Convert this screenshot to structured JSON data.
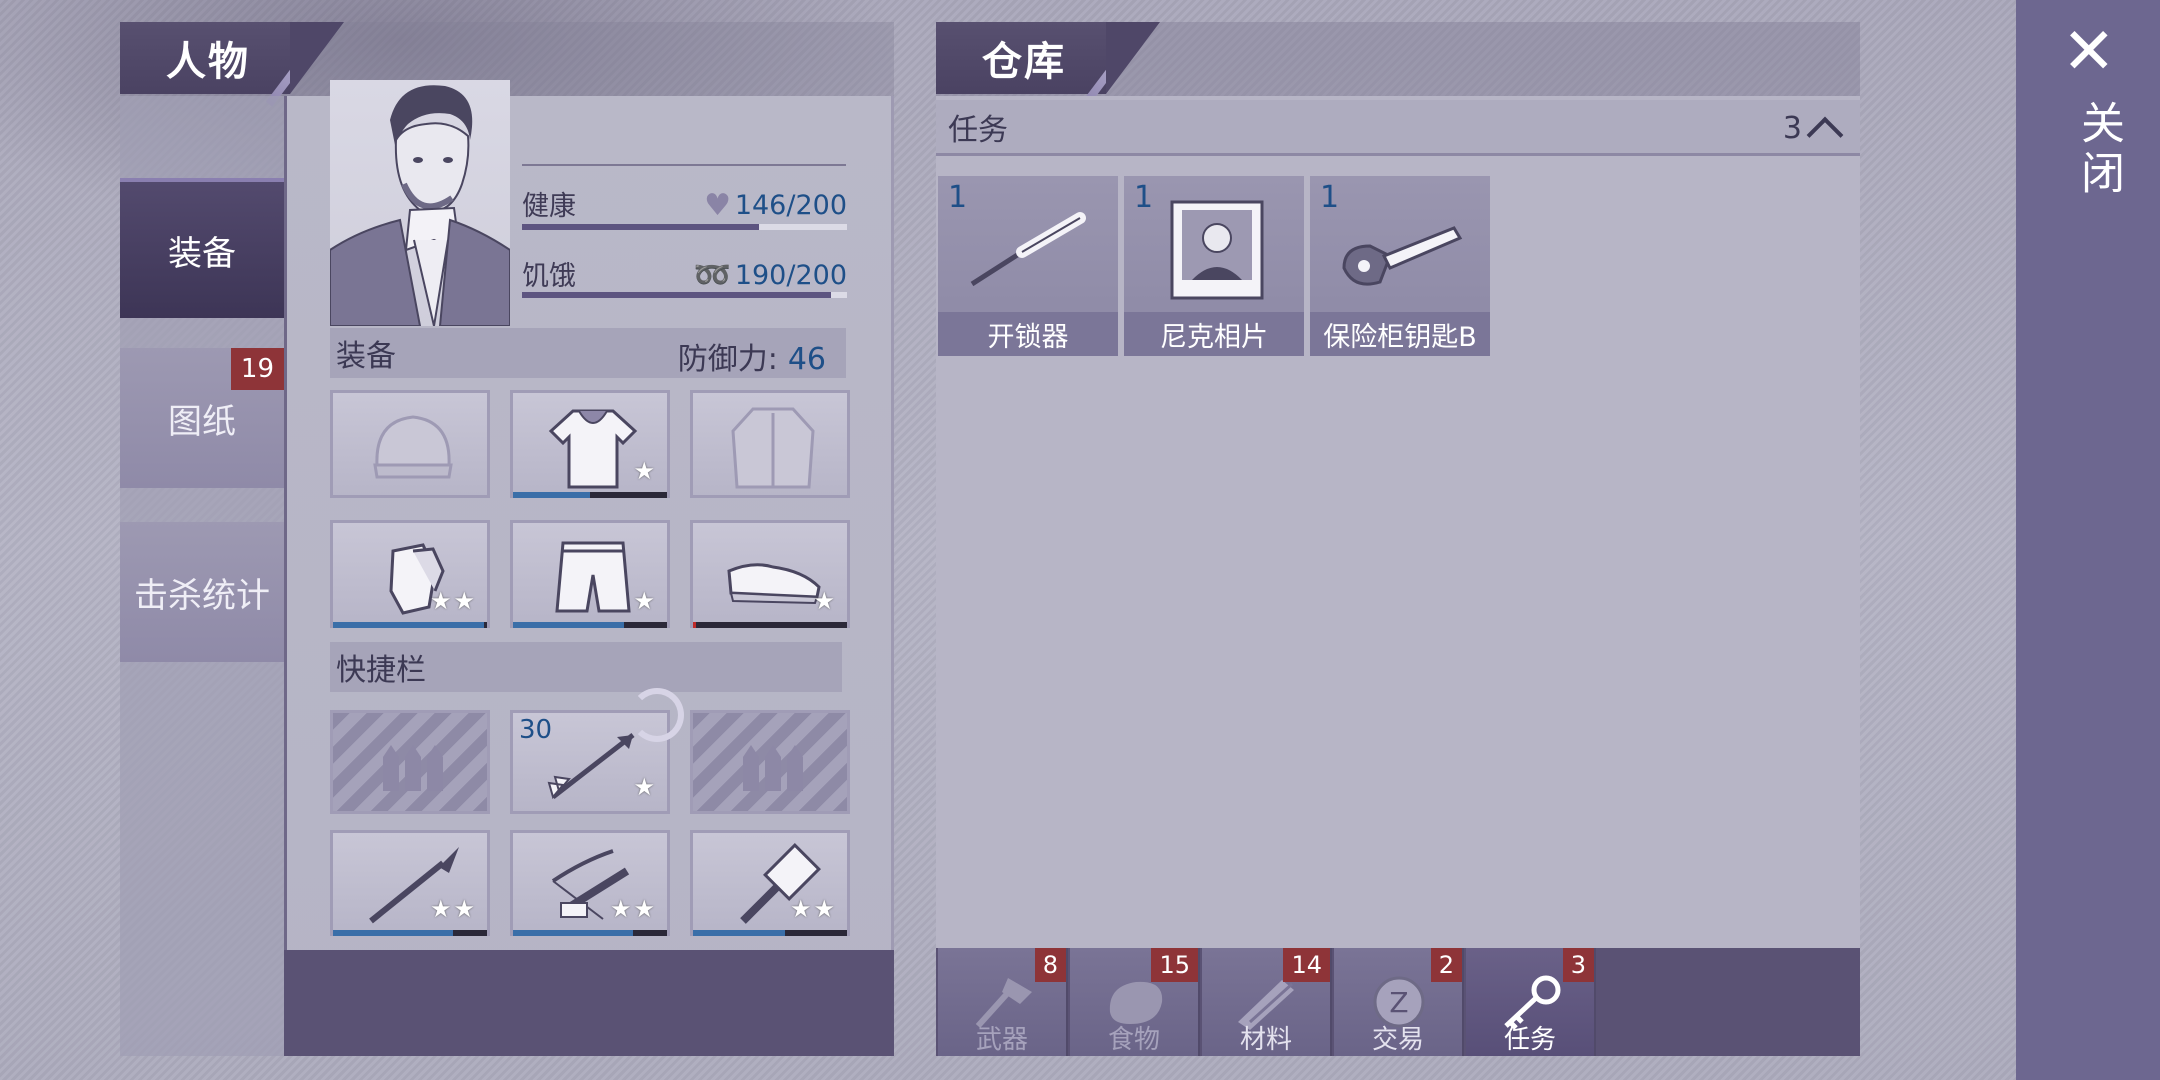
{
  "character_panel": {
    "title": "人物",
    "side_tabs": [
      {
        "label": "装备",
        "active": true
      },
      {
        "label": "图纸",
        "badge": "19"
      },
      {
        "label": "击杀统计"
      }
    ],
    "stats": {
      "health": {
        "label": "健康",
        "value": "146/200",
        "current": 146,
        "max": 200,
        "icon": "heart-icon"
      },
      "hunger": {
        "label": "饥饿",
        "value": "190/200",
        "current": 190,
        "max": 200,
        "icon": "stomach-icon"
      }
    },
    "equipment_section": {
      "label": "装备",
      "defense_label": "防御力:",
      "defense_value": "46"
    },
    "equipment_slots": [
      {
        "item": "beanie-hat",
        "stars": "",
        "durability": null
      },
      {
        "item": "hooded-shirt",
        "stars": "★",
        "durability": 0.5
      },
      {
        "item": "jacket",
        "stars": "",
        "durability": null
      },
      {
        "item": "gloves",
        "stars": "★★",
        "durability": 0.98
      },
      {
        "item": "shorts",
        "stars": "★",
        "durability": 0.72
      },
      {
        "item": "sneakers",
        "stars": "★",
        "durability": 0.02
      }
    ],
    "quickbar_section": {
      "label": "快捷栏"
    },
    "quickbar_slots": [
      {
        "item": "empty-ammo-slot"
      },
      {
        "item": "arrow",
        "qty": "30",
        "stars": "★"
      },
      {
        "item": "empty-ammo-slot"
      },
      {
        "item": "spear",
        "stars": "★★",
        "durability": 0.78
      },
      {
        "item": "crossbow",
        "stars": "★★",
        "durability": 0.78
      },
      {
        "item": "sledgehammer",
        "stars": "★★",
        "durability": 0.6
      }
    ]
  },
  "warehouse_panel": {
    "title": "仓库",
    "section": {
      "label": "任务",
      "count": "3"
    },
    "items": [
      {
        "qty": "1",
        "name": "开锁器",
        "icon": "lockpick-icon"
      },
      {
        "qty": "1",
        "name": "尼克相片",
        "icon": "photo-icon"
      },
      {
        "qty": "1",
        "name": "保险柜钥匙B",
        "icon": "key-icon"
      }
    ],
    "categories": [
      {
        "label": "武器",
        "badge": "8",
        "icon": "axe-icon",
        "active": false
      },
      {
        "label": "食物",
        "badge": "15",
        "icon": "meat-icon",
        "active": false
      },
      {
        "label": "材料",
        "badge": "14",
        "icon": "wood-icon",
        "active": false
      },
      {
        "label": "交易",
        "badge": "2",
        "icon": "coin-icon",
        "active": false
      },
      {
        "label": "任务",
        "badge": "3",
        "icon": "key-icon",
        "active": true
      }
    ]
  },
  "close": {
    "label": "关闭",
    "icon": "close-icon"
  },
  "colors": {
    "accent_blue": "#1e4f88",
    "badge_red": "#8e3438",
    "panel_dark": "#5a5274"
  }
}
